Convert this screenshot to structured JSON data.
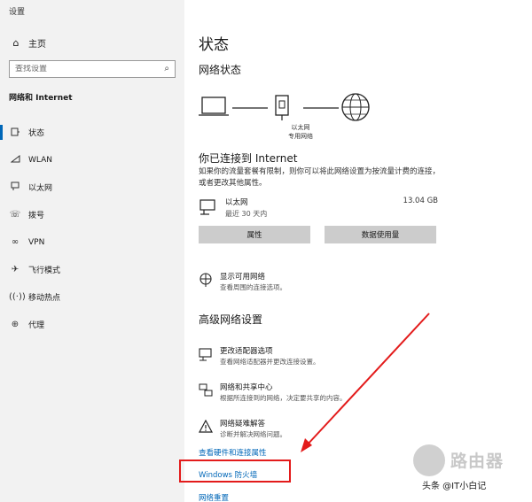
{
  "window": {
    "title": "设置"
  },
  "sidebar": {
    "home_label": "主页",
    "search_placeholder": "查找设置",
    "section_title": "网络和 Internet",
    "items": [
      {
        "label": "状态",
        "icon": "status-icon",
        "active": true
      },
      {
        "label": "WLAN",
        "icon": "wifi-icon",
        "active": false
      },
      {
        "label": "以太网",
        "icon": "ethernet-icon",
        "active": false
      },
      {
        "label": "拨号",
        "icon": "dialup-icon",
        "active": false
      },
      {
        "label": "VPN",
        "icon": "vpn-icon",
        "active": false
      },
      {
        "label": "飞行模式",
        "icon": "airplane-icon",
        "active": false
      },
      {
        "label": "移动热点",
        "icon": "hotspot-icon",
        "active": false
      },
      {
        "label": "代理",
        "icon": "proxy-icon",
        "active": false
      }
    ]
  },
  "main": {
    "page_title": "状态",
    "network_status_title": "网络状态",
    "diagram": {
      "label_line1": "以太网",
      "label_line2": "专用网络"
    },
    "connected_title": "你已连接到 Internet",
    "connected_desc": "如果你的流量套餐有限制，则你可以将此网络设置为按流量计费的连接，或者更改其他属性。",
    "adapter": {
      "name": "以太网",
      "sub": "最近 30 天内",
      "usage": "13.04 GB"
    },
    "buttons": {
      "properties": "属性",
      "data_usage": "数据使用量"
    },
    "show_networks": {
      "title": "显示可用网络",
      "desc": "查看周围的连接选项。"
    },
    "advanced_title": "高级网络设置",
    "adapter_options": {
      "title": "更改适配器选项",
      "desc": "查看网络适配器并更改连接设置。"
    },
    "sharing_center": {
      "title": "网络和共享中心",
      "desc": "根据所连接到的网络，决定要共享的内容。"
    },
    "troubleshoot": {
      "title": "网络疑难解答",
      "desc": "诊断并解决网络问题。"
    },
    "links": {
      "hardware": "查看硬件和连接属性",
      "firewall": "Windows 防火墙",
      "reset": "网络重置"
    }
  },
  "watermark": {
    "brand": "路由器",
    "author": "头条 @IT小白记"
  },
  "colors": {
    "accent": "#0067b8",
    "highlight": "#e31b1b",
    "sidebar_bg": "#f2f2f2",
    "button_bg": "#cccccc"
  }
}
